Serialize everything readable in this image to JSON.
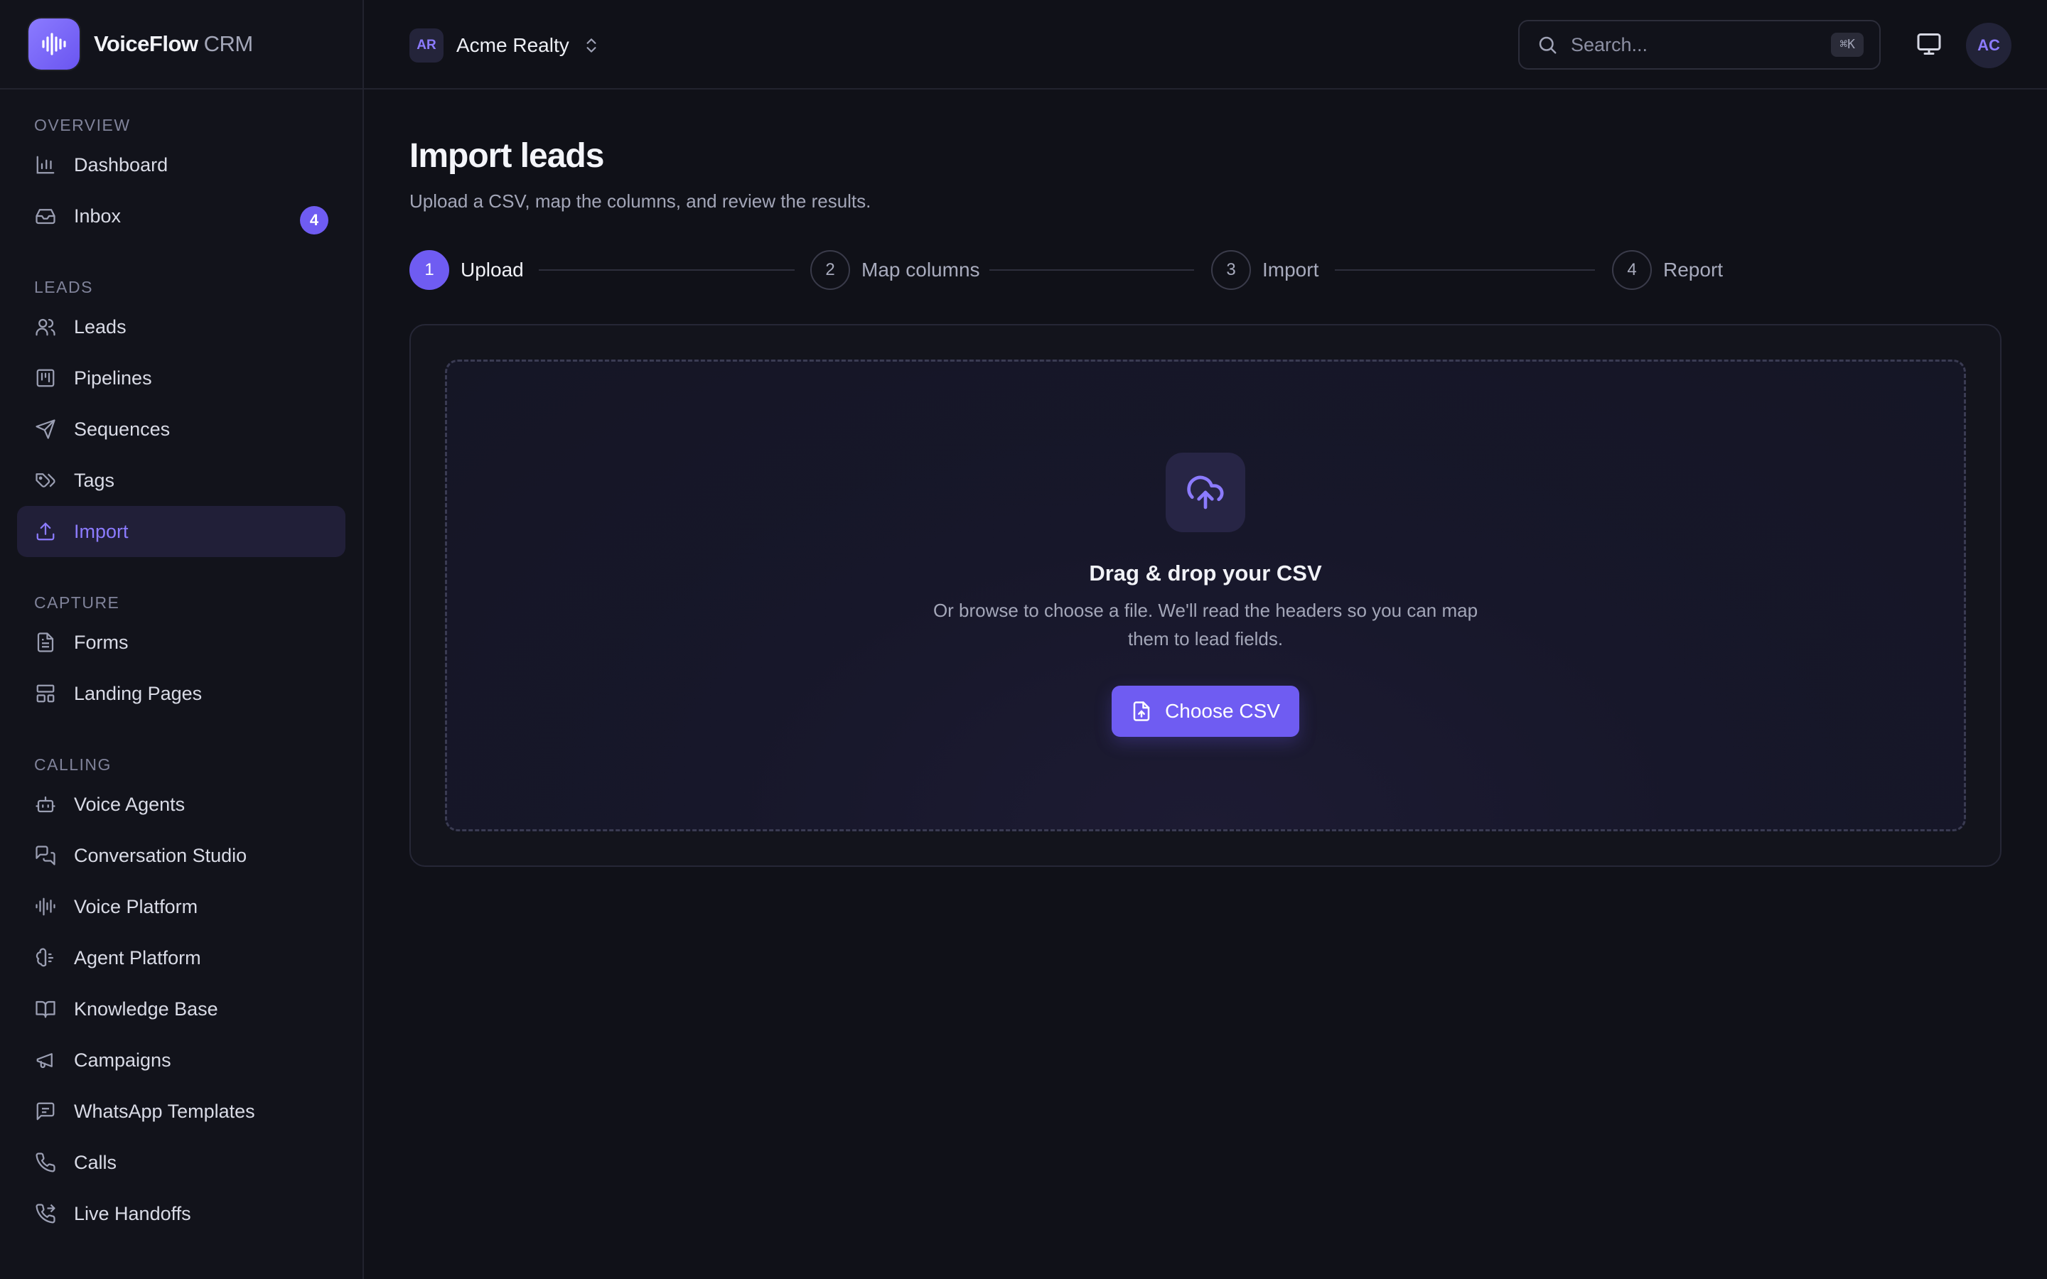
{
  "app": {
    "brand_name": "VoiceFlow",
    "brand_suffix": "CRM",
    "accent_color": "#6f5cf2"
  },
  "sidebar": {
    "sections": [
      {
        "label": "OVERVIEW",
        "items": [
          {
            "label": "Dashboard",
            "icon": "bar-chart-icon"
          },
          {
            "label": "Inbox",
            "icon": "inbox-icon",
            "badge": "4"
          }
        ]
      },
      {
        "label": "LEADS",
        "items": [
          {
            "label": "Leads",
            "icon": "users-icon"
          },
          {
            "label": "Pipelines",
            "icon": "kanban-icon"
          },
          {
            "label": "Sequences",
            "icon": "send-icon"
          },
          {
            "label": "Tags",
            "icon": "tags-icon"
          },
          {
            "label": "Import",
            "icon": "upload-icon",
            "active": true
          }
        ]
      },
      {
        "label": "CAPTURE",
        "items": [
          {
            "label": "Forms",
            "icon": "file-text-icon"
          },
          {
            "label": "Landing Pages",
            "icon": "layout-icon"
          }
        ]
      },
      {
        "label": "CALLING",
        "items": [
          {
            "label": "Voice Agents",
            "icon": "bot-icon"
          },
          {
            "label": "Conversation Studio",
            "icon": "messages-icon"
          },
          {
            "label": "Voice Platform",
            "icon": "audio-lines-icon"
          },
          {
            "label": "Agent Platform",
            "icon": "brain-icon"
          },
          {
            "label": "Knowledge Base",
            "icon": "book-icon"
          },
          {
            "label": "Campaigns",
            "icon": "megaphone-icon"
          },
          {
            "label": "WhatsApp Templates",
            "icon": "message-square-icon"
          },
          {
            "label": "Calls",
            "icon": "phone-icon"
          },
          {
            "label": "Live Handoffs",
            "icon": "phone-forward-icon"
          }
        ]
      }
    ]
  },
  "topbar": {
    "org_initials": "AR",
    "org_name": "Acme Realty",
    "search_placeholder": "Search...",
    "search_shortcut": "⌘K",
    "user_initials": "AC"
  },
  "main": {
    "title": "Import leads",
    "subtitle": "Upload a CSV, map the columns, and review the results.",
    "steps": [
      {
        "num": "1",
        "label": "Upload",
        "active": true
      },
      {
        "num": "2",
        "label": "Map columns"
      },
      {
        "num": "3",
        "label": "Import"
      },
      {
        "num": "4",
        "label": "Report"
      }
    ],
    "dropzone": {
      "title": "Drag & drop your CSV",
      "description": "Or browse to choose a file. We'll read the headers so you can map them to lead fields.",
      "button_label": "Choose CSV"
    }
  }
}
